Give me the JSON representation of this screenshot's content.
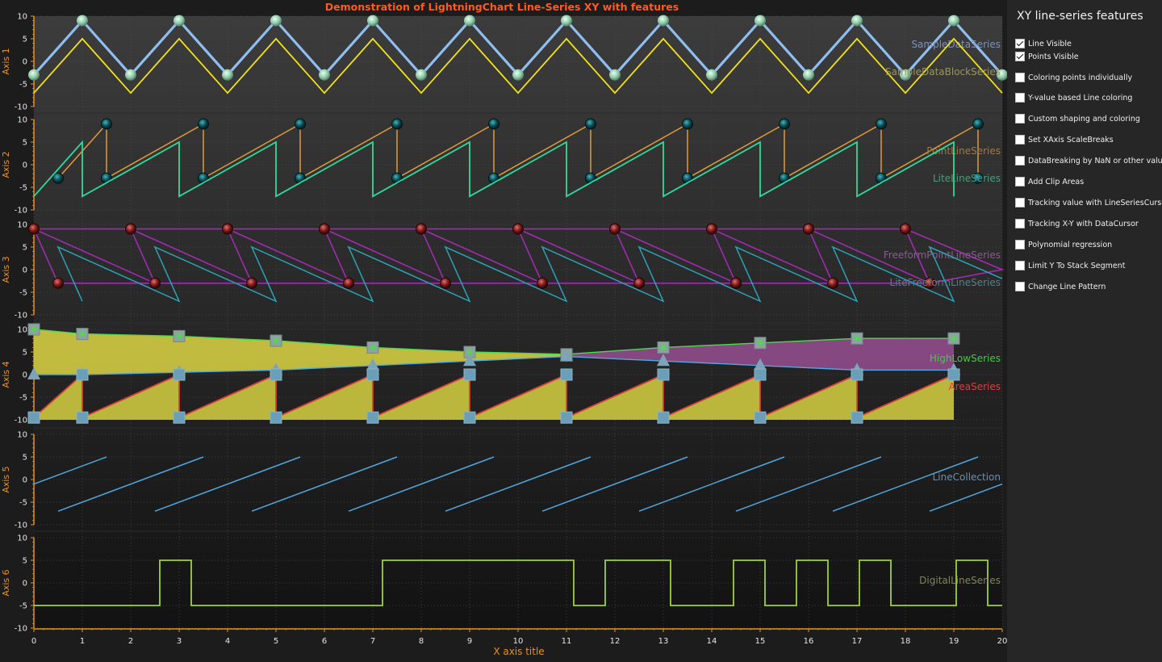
{
  "panel": {
    "title": "XY line-series features",
    "options": [
      {
        "label": "Line Visible",
        "checked": true
      },
      {
        "label": "Points Visible",
        "checked": true
      },
      {
        "label": "Coloring points individually",
        "checked": false
      },
      {
        "label": "Y-value based Line coloring",
        "checked": false
      },
      {
        "label": "Custom shaping and coloring",
        "checked": false
      },
      {
        "label": "Set XAxis ScaleBreaks",
        "checked": false
      },
      {
        "label": "DataBreaking by NaN or other value",
        "checked": false
      },
      {
        "label": "Add Clip Areas",
        "checked": false
      },
      {
        "label": "Tracking value with LineSeriesCursor",
        "checked": false
      },
      {
        "label": "Tracking X-Y with DataCursor",
        "checked": false
      },
      {
        "label": "Polynomial regression",
        "checked": false
      },
      {
        "label": "Limit Y To Stack Segment",
        "checked": false
      },
      {
        "label": "Change Line Pattern",
        "checked": false
      }
    ]
  },
  "chart_data": {
    "type": "line",
    "title": "Demonstration of LightningChart Line-Series XY with features",
    "xlabel": "X axis title",
    "xlim": [
      0,
      20
    ],
    "x_ticks": [
      0,
      1,
      2,
      3,
      4,
      5,
      6,
      7,
      8,
      9,
      10,
      11,
      12,
      13,
      14,
      15,
      16,
      17,
      18,
      19,
      20
    ],
    "y_ticks": [
      10,
      5,
      0,
      -5,
      -10
    ],
    "colors": {
      "title": "#ff5a1f",
      "axis": "#e8921c",
      "background": "#1c1c1c"
    },
    "segments": [
      {
        "axis_label": "Axis 1",
        "ylim": [
          -10,
          10
        ],
        "series": [
          {
            "name": "SampleDataSeries",
            "color": "#8fbef0",
            "label_color": "#7d92b8",
            "x": [
              0,
              1,
              2,
              3,
              4,
              5,
              6,
              7,
              8,
              9,
              10,
              11,
              12,
              13,
              14,
              15,
              16,
              17,
              18,
              19,
              20
            ],
            "y": [
              -3,
              9,
              -3,
              9,
              -3,
              9,
              -3,
              9,
              -3,
              9,
              -3,
              9,
              -3,
              9,
              -3,
              9,
              -3,
              9,
              -3,
              9,
              -3
            ]
          },
          {
            "name": "SampleDataBlockSeries",
            "color": "#f2e21a",
            "label_color": "#9a9560",
            "x": [
              0,
              1,
              2,
              3,
              4,
              5,
              6,
              7,
              8,
              9,
              10,
              11,
              12,
              13,
              14,
              15,
              16,
              17,
              18,
              19,
              20
            ],
            "y": [
              -7,
              5,
              -7,
              5,
              -7,
              5,
              -7,
              5,
              -7,
              5,
              -7,
              5,
              -7,
              5,
              -7,
              5,
              -7,
              5,
              -7,
              5,
              -7
            ]
          }
        ]
      },
      {
        "axis_label": "Axis 2",
        "ylim": [
          -10,
          10
        ],
        "series": [
          {
            "name": "PointLineSeries",
            "color": "#e39a3a",
            "label_color": "#9b7a50",
            "x": [
              0.5,
              1.5,
              1.5,
              3.5,
              3.5,
              5.5,
              5.5,
              7.5,
              7.5,
              9.5,
              9.5,
              11.5,
              11.5,
              13.5,
              13.5,
              15.5,
              15.5,
              17.5,
              17.5,
              19.5,
              19.5
            ],
            "y": [
              -3,
              9,
              -3,
              9,
              -3,
              9,
              -3,
              9,
              -3,
              9,
              -3,
              9,
              -3,
              9,
              -3,
              9,
              -3,
              9,
              -3,
              9,
              -3
            ]
          },
          {
            "name": "LiteLineSeries",
            "color": "#2ddc9c",
            "label_color": "#4a9b7d",
            "x": [
              0,
              1,
              1,
              3,
              3,
              5,
              5,
              7,
              7,
              9,
              9,
              11,
              11,
              13,
              13,
              15,
              15,
              17,
              17,
              19,
              19
            ],
            "y": [
              -7,
              5,
              -7,
              5,
              -7,
              5,
              -7,
              5,
              -7,
              5,
              -7,
              5,
              -7,
              5,
              -7,
              5,
              -7,
              5,
              -7,
              5,
              -7
            ]
          }
        ]
      },
      {
        "axis_label": "Axis 3",
        "ylim": [
          -10,
          10
        ],
        "series": [
          {
            "name": "FreeformPointLineSeries",
            "color": "#a02bb0",
            "label_color": "#8a5d8f",
            "x": [
              0,
              2.5,
              0.5,
              0,
              2,
              4.5,
              2.5,
              2,
              4,
              6.5,
              4.5,
              4,
              6,
              8.5,
              6.5,
              6,
              8,
              10.5,
              8.5,
              8,
              10,
              12.5,
              10.5,
              10,
              12,
              14.5,
              12.5,
              12,
              14,
              16.5,
              14.5,
              14,
              16,
              18.5,
              16.5,
              16,
              18,
              20,
              18.5,
              18
            ],
            "y": [
              9,
              -3,
              -3,
              9,
              9,
              -3,
              -3,
              9,
              9,
              -3,
              -3,
              9,
              9,
              -3,
              -3,
              9,
              9,
              -3,
              -3,
              9,
              9,
              -3,
              -3,
              9,
              9,
              -3,
              -3,
              9,
              9,
              -3,
              -3,
              9,
              9,
              -3,
              -3,
              9,
              9,
              0,
              -3,
              9
            ]
          },
          {
            "name": "LiteFreeformLineSeries",
            "color": "#2ca3b5",
            "label_color": "#557f88",
            "x": [
              1,
              0.5,
              3,
              3,
              2.5,
              5,
              5,
              4.5,
              7,
              7,
              6.5,
              9,
              9,
              8.5,
              11,
              11,
              10.5,
              13,
              13,
              12.5,
              15,
              15,
              14.5,
              17,
              17,
              16.5,
              19,
              19,
              18.5,
              20
            ],
            "y": [
              -7,
              5,
              -7,
              -7,
              5,
              -7,
              -7,
              5,
              -7,
              -7,
              5,
              -7,
              -7,
              5,
              -7,
              -7,
              5,
              -7,
              -7,
              5,
              -7,
              -7,
              5,
              -7,
              -7,
              5,
              -7,
              -7,
              5,
              -2
            ]
          }
        ]
      },
      {
        "axis_label": "Axis 4",
        "ylim": [
          -10,
          10
        ],
        "series": [
          {
            "name": "HighLowSeries",
            "color": "#3fce3f",
            "label_color": "#3fce3f",
            "x": [
              0,
              1,
              3,
              5,
              7,
              9,
              11,
              13,
              15,
              17,
              19
            ],
            "high": [
              10,
              9,
              8.5,
              7.5,
              6,
              5,
              4.5,
              6,
              7,
              8,
              8
            ],
            "low": [
              0,
              0,
              0.5,
              1,
              2,
              3,
              4,
              3,
              2,
              1,
              1
            ]
          },
          {
            "name": "AreaSeries",
            "color": "#d84040",
            "label_color": "#d84040",
            "x": [
              0,
              1,
              1,
              3,
              3,
              5,
              5,
              7,
              7,
              9,
              9,
              11,
              11,
              13,
              13,
              15,
              15,
              17,
              17,
              19
            ],
            "y": [
              -9.5,
              0,
              -9.5,
              0,
              -9.5,
              0,
              -9.5,
              0,
              -9.5,
              0,
              -9.5,
              0,
              -9.5,
              0,
              -9.5,
              0,
              -9.5,
              0,
              -9.5,
              0
            ]
          }
        ]
      },
      {
        "axis_label": "Axis 5",
        "ylim": [
          -10,
          10
        ],
        "series": [
          {
            "name": "LineCollection",
            "color": "#4fa8e0",
            "label_color": "#6f8ea8",
            "segments": [
              [
                [
                  0,
                  -1
                ],
                [
                  1.5,
                  5
                ]
              ],
              [
                [
                  0.5,
                  -7
                ],
                [
                  3.5,
                  5
                ]
              ],
              [
                [
                  2.5,
                  -7
                ],
                [
                  5.5,
                  5
                ]
              ],
              [
                [
                  4.5,
                  -7
                ],
                [
                  7.5,
                  5
                ]
              ],
              [
                [
                  6.5,
                  -7
                ],
                [
                  9.5,
                  5
                ]
              ],
              [
                [
                  8.5,
                  -7
                ],
                [
                  11.5,
                  5
                ]
              ],
              [
                [
                  10.5,
                  -7
                ],
                [
                  13.5,
                  5
                ]
              ],
              [
                [
                  12.5,
                  -7
                ],
                [
                  15.5,
                  5
                ]
              ],
              [
                [
                  14.5,
                  -7
                ],
                [
                  17.5,
                  5
                ]
              ],
              [
                [
                  16.5,
                  -7
                ],
                [
                  19.5,
                  5
                ]
              ],
              [
                [
                  18.5,
                  -7
                ],
                [
                  20,
                  -1
                ]
              ]
            ]
          }
        ]
      },
      {
        "axis_label": "Axis 6",
        "ylim": [
          -10,
          10
        ],
        "series": [
          {
            "name": "DigitalLineSeries",
            "color": "#9ed13a",
            "label_color": "#7d8460",
            "x": [
              0,
              2.6,
              2.6,
              3.25,
              3.25,
              7.2,
              7.2,
              11.15,
              11.15,
              11.8,
              11.8,
              13.15,
              13.15,
              14.45,
              14.45,
              15.1,
              15.1,
              15.75,
              15.75,
              16.4,
              16.4,
              17.05,
              17.05,
              17.7,
              17.7,
              19.05,
              19.05,
              19.7,
              19.7,
              20
            ],
            "y": [
              -5,
              -5,
              5,
              5,
              -5,
              -5,
              5,
              5,
              -5,
              -5,
              5,
              5,
              -5,
              -5,
              5,
              5,
              -5,
              -5,
              5,
              5,
              -5,
              -5,
              5,
              5,
              -5,
              -5,
              5,
              5,
              -5,
              -5
            ]
          }
        ]
      }
    ]
  }
}
